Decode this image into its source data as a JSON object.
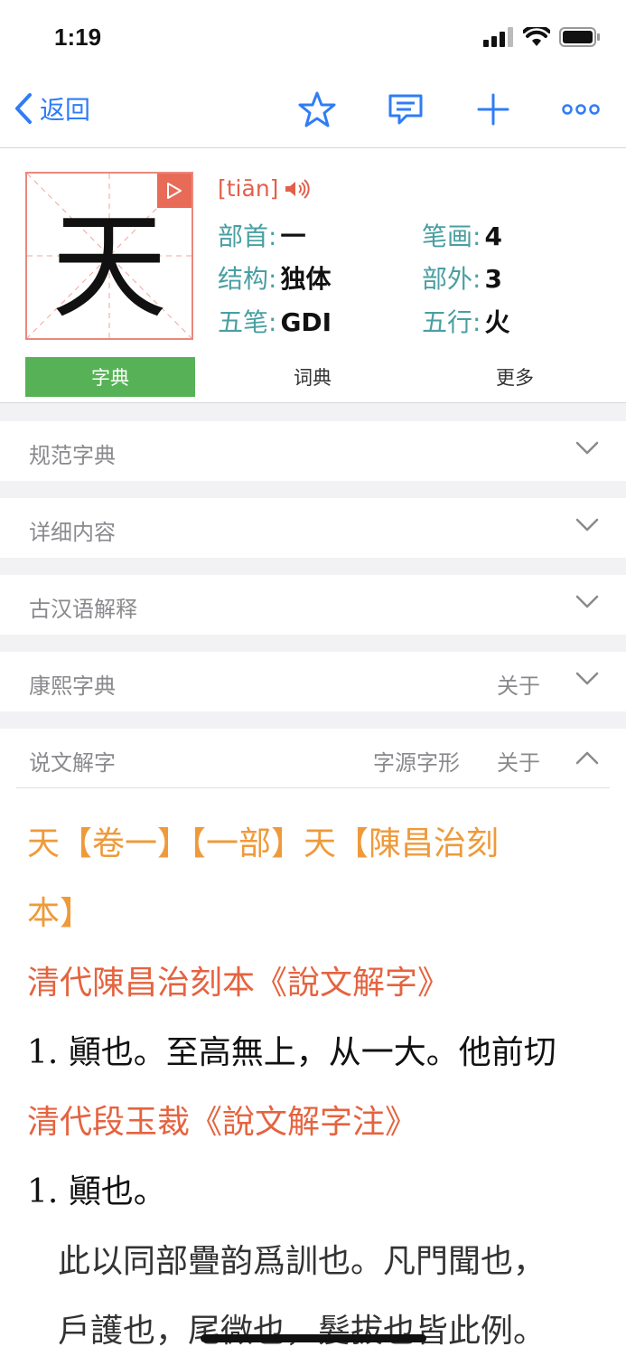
{
  "status": {
    "time": "1:19"
  },
  "nav": {
    "back_label": "返回"
  },
  "character": {
    "glyph": "天",
    "pinyin": "[tiān]",
    "radical_label": "部首:",
    "radical_value": "一",
    "strokes_label": "笔画:",
    "strokes_value": "4",
    "structure_label": "结构:",
    "structure_value": "独体",
    "extra_strokes_label": "部外:",
    "extra_strokes_value": "3",
    "wubi_label": "五笔:",
    "wubi_value": "GDI",
    "wuxing_label": "五行:",
    "wuxing_value": "火"
  },
  "tabs": [
    {
      "label": "字典",
      "active": true
    },
    {
      "label": "词典",
      "active": false
    },
    {
      "label": "更多",
      "active": false
    }
  ],
  "sections": [
    {
      "title": "规范字典"
    },
    {
      "title": "详细内容"
    },
    {
      "title": "古汉语解释"
    },
    {
      "title": "康熙字典",
      "link": "关于"
    },
    {
      "title": "说文解字",
      "link_source": "字源字形",
      "link": "关于",
      "expanded": true
    }
  ],
  "content": {
    "line1": "天【卷一】【一部】天【陳昌治刻",
    "line2": "本】",
    "line3": "清代陳昌治刻本《說文解字》",
    "line4": "1. 顚也。至高無上，从一大。他前切",
    "line5": "清代段玉裁《說文解字注》",
    "line6": "1. 顚也。",
    "line7": "此以同部疊韵爲訓也。凡門聞也，",
    "line8": "戶護也，尾微也，髮拔也皆此例。"
  },
  "colors": {
    "accent_blue": "#2f7cf6",
    "tab_active_green": "#57b257",
    "label_teal": "#4a9fa1",
    "pinyin_red": "#e35f4b",
    "heading_orange": "#ef9a3a"
  }
}
